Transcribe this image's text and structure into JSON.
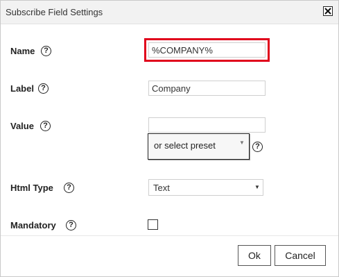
{
  "dialog": {
    "title": "Subscribe Field Settings",
    "close_icon": "close-x-icon"
  },
  "form": {
    "name_label": "Name",
    "name_value": "%COMPANY%",
    "label_label": "Label",
    "label_value": "Company",
    "value_label": "Value",
    "value_value": "",
    "preset_placeholder": "or select preset",
    "html_type_label": "Html Type",
    "html_type_selected": "Text",
    "mandatory_label": "Mandatory",
    "mandatory_checked": false,
    "help_glyph": "?"
  },
  "buttons": {
    "ok": "Ok",
    "cancel": "Cancel"
  },
  "colors": {
    "highlight": "#e0001b",
    "titlebar_bg": "#f2f2f2"
  }
}
